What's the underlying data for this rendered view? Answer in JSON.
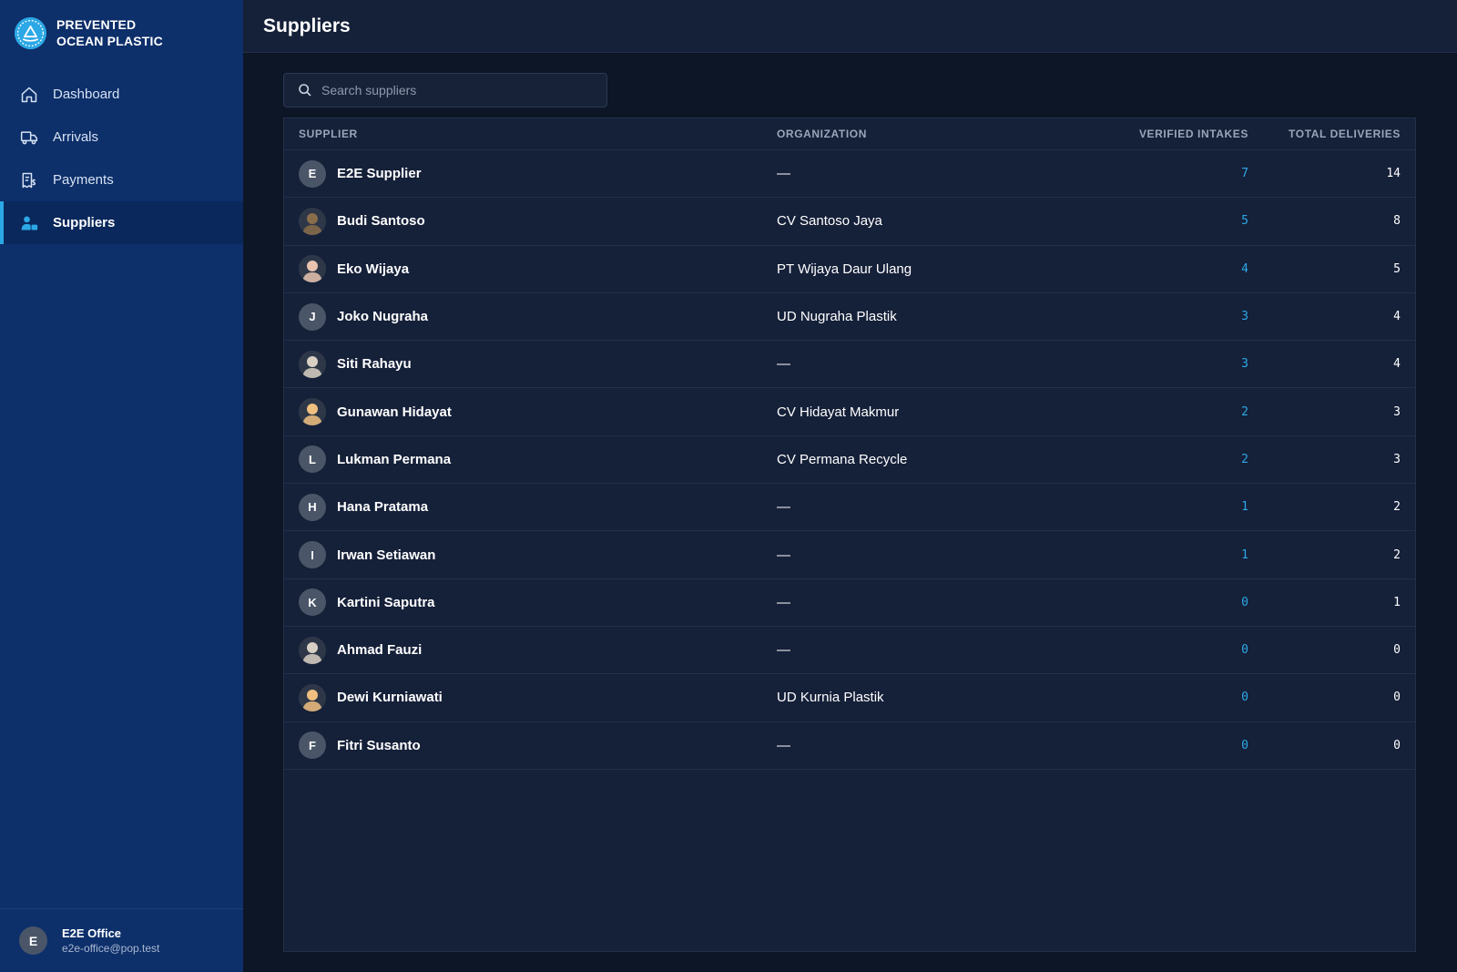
{
  "brand": {
    "line1": "PREVENTED",
    "line2": "OCEAN PLASTIC"
  },
  "nav": [
    {
      "label": "Dashboard",
      "icon": "home-icon",
      "active": false
    },
    {
      "label": "Arrivals",
      "icon": "truck-icon",
      "active": false
    },
    {
      "label": "Payments",
      "icon": "receipt-dollar-icon",
      "active": false
    },
    {
      "label": "Suppliers",
      "icon": "user-group-icon",
      "active": true
    }
  ],
  "user": {
    "initial": "E",
    "name": "E2E Office",
    "email": "e2e-office@pop.test"
  },
  "page": {
    "title": "Suppliers"
  },
  "search": {
    "placeholder": "Search suppliers",
    "value": ""
  },
  "table": {
    "headers": {
      "supplier": "SUPPLIER",
      "organization": "ORGANIZATION",
      "verified": "VERIFIED INTAKES",
      "total": "TOTAL DELIVERIES"
    },
    "rows": [
      {
        "avatar": "E",
        "avatar_type": "initial",
        "name": "E2E Supplier",
        "organization": "—",
        "verified": "7",
        "total": "14"
      },
      {
        "avatar": "photo",
        "avatar_type": "photo",
        "name": "Budi Santoso",
        "organization": "CV Santoso Jaya",
        "verified": "5",
        "total": "8"
      },
      {
        "avatar": "photo",
        "avatar_type": "photo",
        "name": "Eko Wijaya",
        "organization": "PT Wijaya Daur Ulang",
        "verified": "4",
        "total": "5"
      },
      {
        "avatar": "J",
        "avatar_type": "initial",
        "name": "Joko Nugraha",
        "organization": "UD Nugraha Plastik",
        "verified": "3",
        "total": "4"
      },
      {
        "avatar": "photo",
        "avatar_type": "photo",
        "name": "Siti Rahayu",
        "organization": "—",
        "verified": "3",
        "total": "4"
      },
      {
        "avatar": "photo",
        "avatar_type": "photo",
        "name": "Gunawan Hidayat",
        "organization": "CV Hidayat Makmur",
        "verified": "2",
        "total": "3"
      },
      {
        "avatar": "L",
        "avatar_type": "initial",
        "name": "Lukman Permana",
        "organization": "CV Permana Recycle",
        "verified": "2",
        "total": "3"
      },
      {
        "avatar": "H",
        "avatar_type": "initial",
        "name": "Hana Pratama",
        "organization": "—",
        "verified": "1",
        "total": "2"
      },
      {
        "avatar": "I",
        "avatar_type": "initial",
        "name": "Irwan Setiawan",
        "organization": "—",
        "verified": "1",
        "total": "2"
      },
      {
        "avatar": "K",
        "avatar_type": "initial",
        "name": "Kartini Saputra",
        "organization": "—",
        "verified": "0",
        "total": "1"
      },
      {
        "avatar": "photo",
        "avatar_type": "photo",
        "name": "Ahmad Fauzi",
        "organization": "—",
        "verified": "0",
        "total": "0"
      },
      {
        "avatar": "photo",
        "avatar_type": "photo",
        "name": "Dewi Kurniawati",
        "organization": "UD Kurnia Plastik",
        "verified": "0",
        "total": "0"
      },
      {
        "avatar": "F",
        "avatar_type": "initial",
        "name": "Fitri Susanto",
        "organization": "—",
        "verified": "0",
        "total": "0"
      }
    ]
  },
  "colors": {
    "sidebar": "#0d2f6a",
    "accent": "#2ca8e6",
    "background": "#0d1626",
    "panel": "#152039"
  }
}
